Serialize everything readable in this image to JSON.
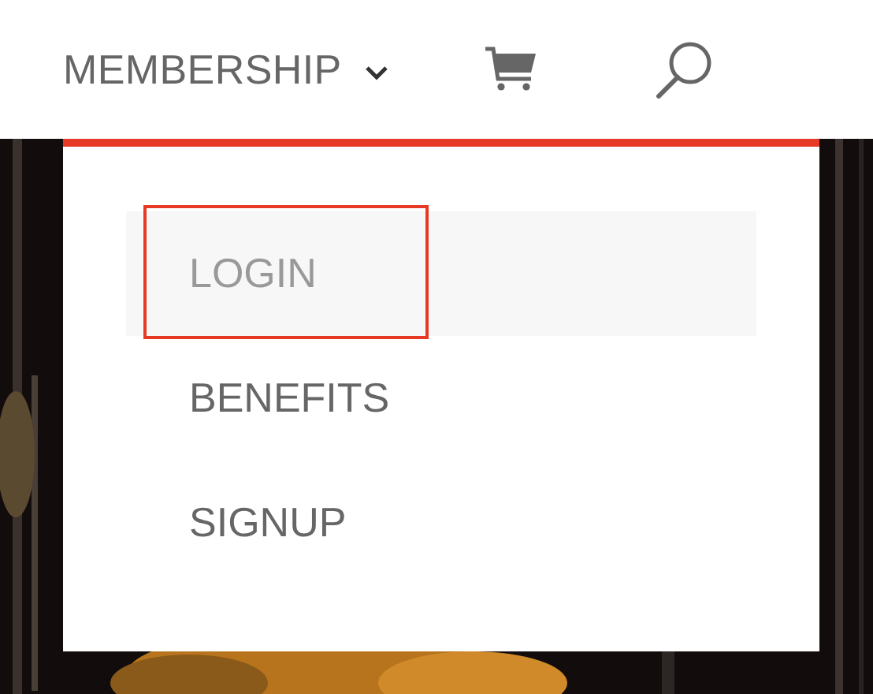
{
  "nav": {
    "label": "MEMBERSHIP",
    "expanded": true
  },
  "menu": [
    {
      "label": "LOGIN",
      "selected": true
    },
    {
      "label": "BENEFITS",
      "selected": false
    },
    {
      "label": "SIGNUP",
      "selected": false
    }
  ]
}
